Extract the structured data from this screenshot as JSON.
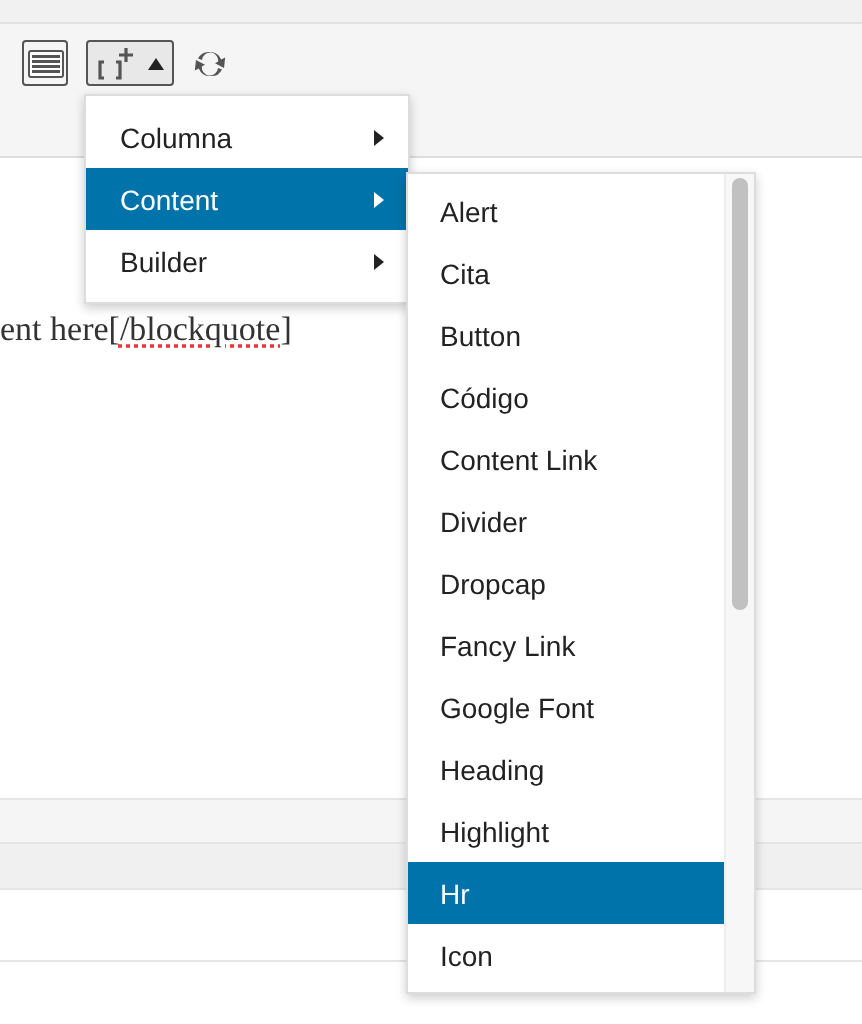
{
  "toolbar": {
    "menu_open": true
  },
  "editor_line": {
    "before": "ent here[",
    "misspelled": "/blockquote",
    "after": "]"
  },
  "menu": [
    {
      "label": "Columna",
      "selected": false,
      "has_submenu": true
    },
    {
      "label": "Content",
      "selected": true,
      "has_submenu": true
    },
    {
      "label": "Builder",
      "selected": false,
      "has_submenu": true
    }
  ],
  "submenu": [
    {
      "label": "Alert",
      "selected": false
    },
    {
      "label": "Cita",
      "selected": false
    },
    {
      "label": "Button",
      "selected": false
    },
    {
      "label": "Código",
      "selected": false
    },
    {
      "label": "Content Link",
      "selected": false
    },
    {
      "label": "Divider",
      "selected": false
    },
    {
      "label": "Dropcap",
      "selected": false
    },
    {
      "label": "Fancy Link",
      "selected": false
    },
    {
      "label": "Google Font",
      "selected": false
    },
    {
      "label": "Heading",
      "selected": false
    },
    {
      "label": "Highlight",
      "selected": false
    },
    {
      "label": "Hr",
      "selected": true
    },
    {
      "label": "Icon",
      "selected": false
    }
  ]
}
